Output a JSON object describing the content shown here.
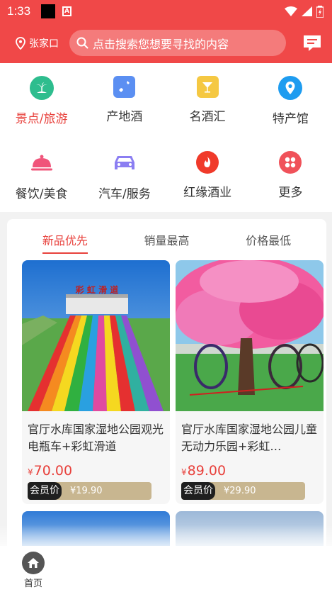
{
  "status_bar": {
    "time": "1:33",
    "a_badge": "A"
  },
  "header": {
    "location": "张家口",
    "search_placeholder": "点击搜索您想要寻找的内容"
  },
  "categories": [
    {
      "label": "景点/旅游",
      "icon": "island-icon",
      "color": "#2ebd8e",
      "active": true
    },
    {
      "label": "产地酒",
      "icon": "bottle-icon",
      "color": "#5b8ff2",
      "active": false
    },
    {
      "label": "名酒汇",
      "icon": "cocktail-icon",
      "color": "#f5c842",
      "active": false
    },
    {
      "label": "特产馆",
      "icon": "map-pin-icon",
      "color": "#1e9cf0",
      "active": false
    },
    {
      "label": "餐饮/美食",
      "icon": "food-cover-icon",
      "color": "#f0547a",
      "active": false
    },
    {
      "label": "汽车/服务",
      "icon": "car-icon",
      "color": "#8b7ef2",
      "active": false
    },
    {
      "label": "红缘酒业",
      "icon": "flame-icon",
      "color": "#f03a2a",
      "active": false
    },
    {
      "label": "更多",
      "icon": "grid-icon",
      "color": "#f0525a",
      "active": false
    }
  ],
  "tabs": [
    {
      "label": "新品优先",
      "active": true
    },
    {
      "label": "销量最高",
      "active": false
    },
    {
      "label": "价格最低",
      "active": false
    }
  ],
  "products": [
    {
      "title": "官厅水库国家湿地公园观光电瓶车+彩虹滑道",
      "currency": "¥",
      "price": "70.00",
      "member_tag": "会员价",
      "member_price": "¥19.90",
      "image": "rainbow-slide-image",
      "sign_text": "彩 虹 滑 道"
    },
    {
      "title": "官厅水库国家湿地公园儿童无动力乐园+彩虹…",
      "currency": "¥",
      "price": "89.00",
      "member_tag": "会员价",
      "member_price": "¥29.90",
      "image": "pink-blossom-tree-image"
    }
  ],
  "bottom_nav": {
    "home_label": "首页"
  }
}
